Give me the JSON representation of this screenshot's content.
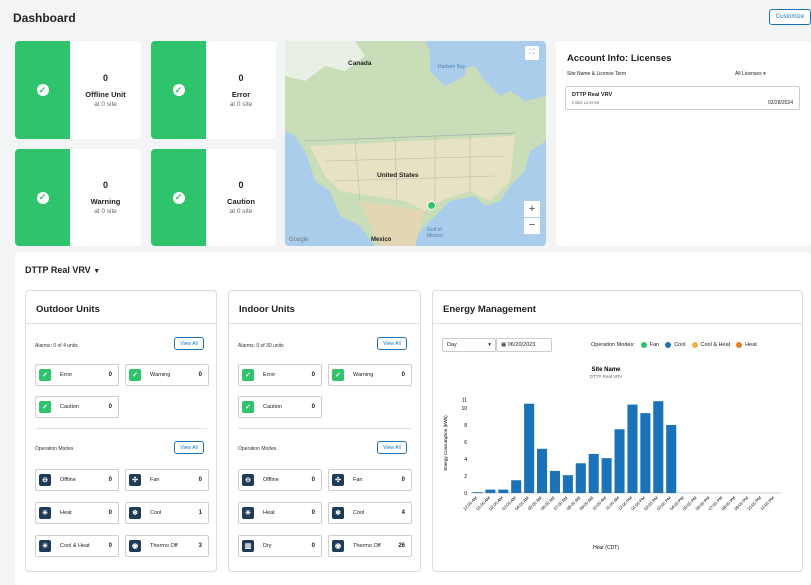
{
  "header": {
    "title": "Dashboard",
    "customize_label": "Customize"
  },
  "stats": [
    {
      "count": "0",
      "label": "Offline Unit",
      "sub": "at 0 site"
    },
    {
      "count": "0",
      "label": "Error",
      "sub": "at 0 site"
    },
    {
      "count": "0",
      "label": "Warning",
      "sub": "at 0 site"
    },
    {
      "count": "0",
      "label": "Caution",
      "sub": "at 0 site"
    }
  ],
  "map": {
    "labels": {
      "canada": "Canada",
      "hudson": "Hudson Bay",
      "us": "United States",
      "mexico": "Mexico",
      "gulf1": "Gulf of",
      "gulf2": "Mexico",
      "google": "Google"
    },
    "zoom_in": "+",
    "zoom_out": "−"
  },
  "account": {
    "title": "Account Info: Licenses",
    "term_label": "Site Name & License Term",
    "filter": "All Licenses",
    "row": {
      "name": "DTTP Real VRV",
      "type": "Initial License",
      "date": "02/28/2024"
    }
  },
  "site": {
    "name": "DTTP Real VRV"
  },
  "outdoor": {
    "title": "Outdoor Units",
    "alarms": "Alarms: 0 of 4 units",
    "view_all": "View All",
    "alarm_chips": [
      {
        "label": "Error",
        "value": "0"
      },
      {
        "label": "Warning",
        "value": "0"
      },
      {
        "label": "Caution",
        "value": "0"
      }
    ],
    "modes_title": "Operation Modes",
    "modes_view_all": "View All",
    "modes": [
      {
        "label": "Offline",
        "value": "0",
        "icon": "offline-icon"
      },
      {
        "label": "Fan",
        "value": "0",
        "icon": "fan-icon"
      },
      {
        "label": "Heat",
        "value": "0",
        "icon": "heat-icon"
      },
      {
        "label": "Cool",
        "value": "1",
        "icon": "cool-icon"
      },
      {
        "label": "Cool & Heat",
        "value": "0",
        "icon": "cool-heat-icon"
      },
      {
        "label": "Thermo Off",
        "value": "3",
        "icon": "thermo-off-icon"
      }
    ]
  },
  "indoor": {
    "title": "Indoor Units",
    "alarms": "Alarms: 0 of 30 units",
    "view_all": "View All",
    "alarm_chips": [
      {
        "label": "Error",
        "value": "0"
      },
      {
        "label": "Warning",
        "value": "0"
      },
      {
        "label": "Caution",
        "value": "0"
      }
    ],
    "modes_title": "Operation Modes",
    "modes_view_all": "View All",
    "modes": [
      {
        "label": "Offline",
        "value": "0",
        "icon": "offline-icon"
      },
      {
        "label": "Fan",
        "value": "0",
        "icon": "fan-icon"
      },
      {
        "label": "Heat",
        "value": "0",
        "icon": "heat-icon"
      },
      {
        "label": "Cool",
        "value": "4",
        "icon": "cool-icon"
      },
      {
        "label": "Dry",
        "value": "0",
        "icon": "dry-icon"
      },
      {
        "label": "Thermo Off",
        "value": "26",
        "icon": "thermo-off-icon"
      }
    ]
  },
  "energy": {
    "title": "Energy Management",
    "period": "Day",
    "date": "06/20/2023",
    "modes_label": "Operation Modes:",
    "legend": [
      {
        "name": "Fan",
        "color": "#2fc46b"
      },
      {
        "name": "Cool",
        "color": "#1a73b8"
      },
      {
        "name": "Cool & Heat",
        "color": "#f5b041"
      },
      {
        "name": "Heat",
        "color": "#e67e22"
      }
    ]
  },
  "chart_data": {
    "type": "bar",
    "title": "Site Name",
    "subtitle": "DTTP Real VRV",
    "ylabel": "Energy Consumption (kWh)",
    "xlabel": "Hour (CDT)",
    "ylim": [
      0,
      12
    ],
    "yticks": [
      "0",
      "2",
      "4",
      "6",
      "8",
      "10",
      "11"
    ],
    "bar_color": "#1a73b8",
    "categories": [
      "12:00 AM",
      "01:00 AM",
      "02:00 AM",
      "03:00 AM",
      "04:00 AM",
      "05:00 AM",
      "06:00 AM",
      "07:00 AM",
      "08:00 AM",
      "09:00 AM",
      "10:00 AM",
      "11:00 AM",
      "12:00 PM",
      "01:00 PM",
      "02:00 PM",
      "03:00 PM",
      "04:00 PM",
      "05:00 PM",
      "06:00 PM",
      "07:00 PM",
      "08:00 PM",
      "09:00 PM",
      "10:00 PM",
      "11:00 PM"
    ],
    "values": [
      0.1,
      0.4,
      0.4,
      1.5,
      10.5,
      5.2,
      2.6,
      2.1,
      3.5,
      4.6,
      4.1,
      7.5,
      10.4,
      9.4,
      10.8,
      8.0,
      0,
      0,
      0,
      0,
      0,
      0,
      0,
      0
    ]
  }
}
